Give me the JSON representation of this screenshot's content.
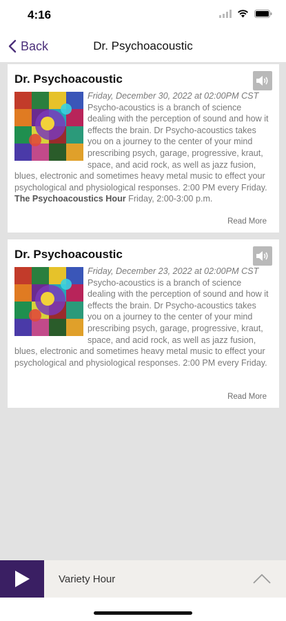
{
  "status": {
    "time": "4:16"
  },
  "nav": {
    "back_label": "Back",
    "title": "Dr. Psychoacoustic"
  },
  "posts": [
    {
      "title": "Dr. Psychoacoustic",
      "date": "Friday, December 30, 2022 at 02:00PM CST",
      "description": "Psycho-acoustics is a branch of science dealing with the perception of sound and how it effects the brain. Dr Psycho-acoustics takes you on a journey to the center of your mind prescribing psych, garage, progressive, kraut, space, and acid rock, as well as jazz fusion, blues, electronic and sometimes heavy metal music to effect your psychological and physiological responses. 2:00 PM every Friday. ",
      "show_name": "The Psychoacoustics Hour",
      "schedule": " Friday, 2:00-3:00 p.m.",
      "read_more": "Read More"
    },
    {
      "title": "Dr. Psychoacoustic",
      "date": "Friday, December 23, 2022 at 02:00PM CST",
      "description": "Psycho-acoustics is a branch of science dealing with the perception of sound and how it effects the brain. Dr Psycho-acoustics takes you on a journey to the center of your mind prescribing psych, garage, progressive, kraut, space, and acid rock, as well as jazz fusion, blues, electronic and sometimes heavy metal music to effect your psychological and physiological responses. 2:00 PM every Friday.",
      "read_more": "Read More"
    }
  ],
  "player": {
    "title": "Variety Hour"
  },
  "colors": {
    "accent": "#3a1f63",
    "back_link": "#4b2f7a",
    "background": "#e2e2e2"
  },
  "icons": [
    "back-chevron-icon",
    "speaker-icon",
    "play-icon",
    "chevron-up-icon",
    "wifi-icon",
    "battery-icon",
    "signal-icon"
  ]
}
